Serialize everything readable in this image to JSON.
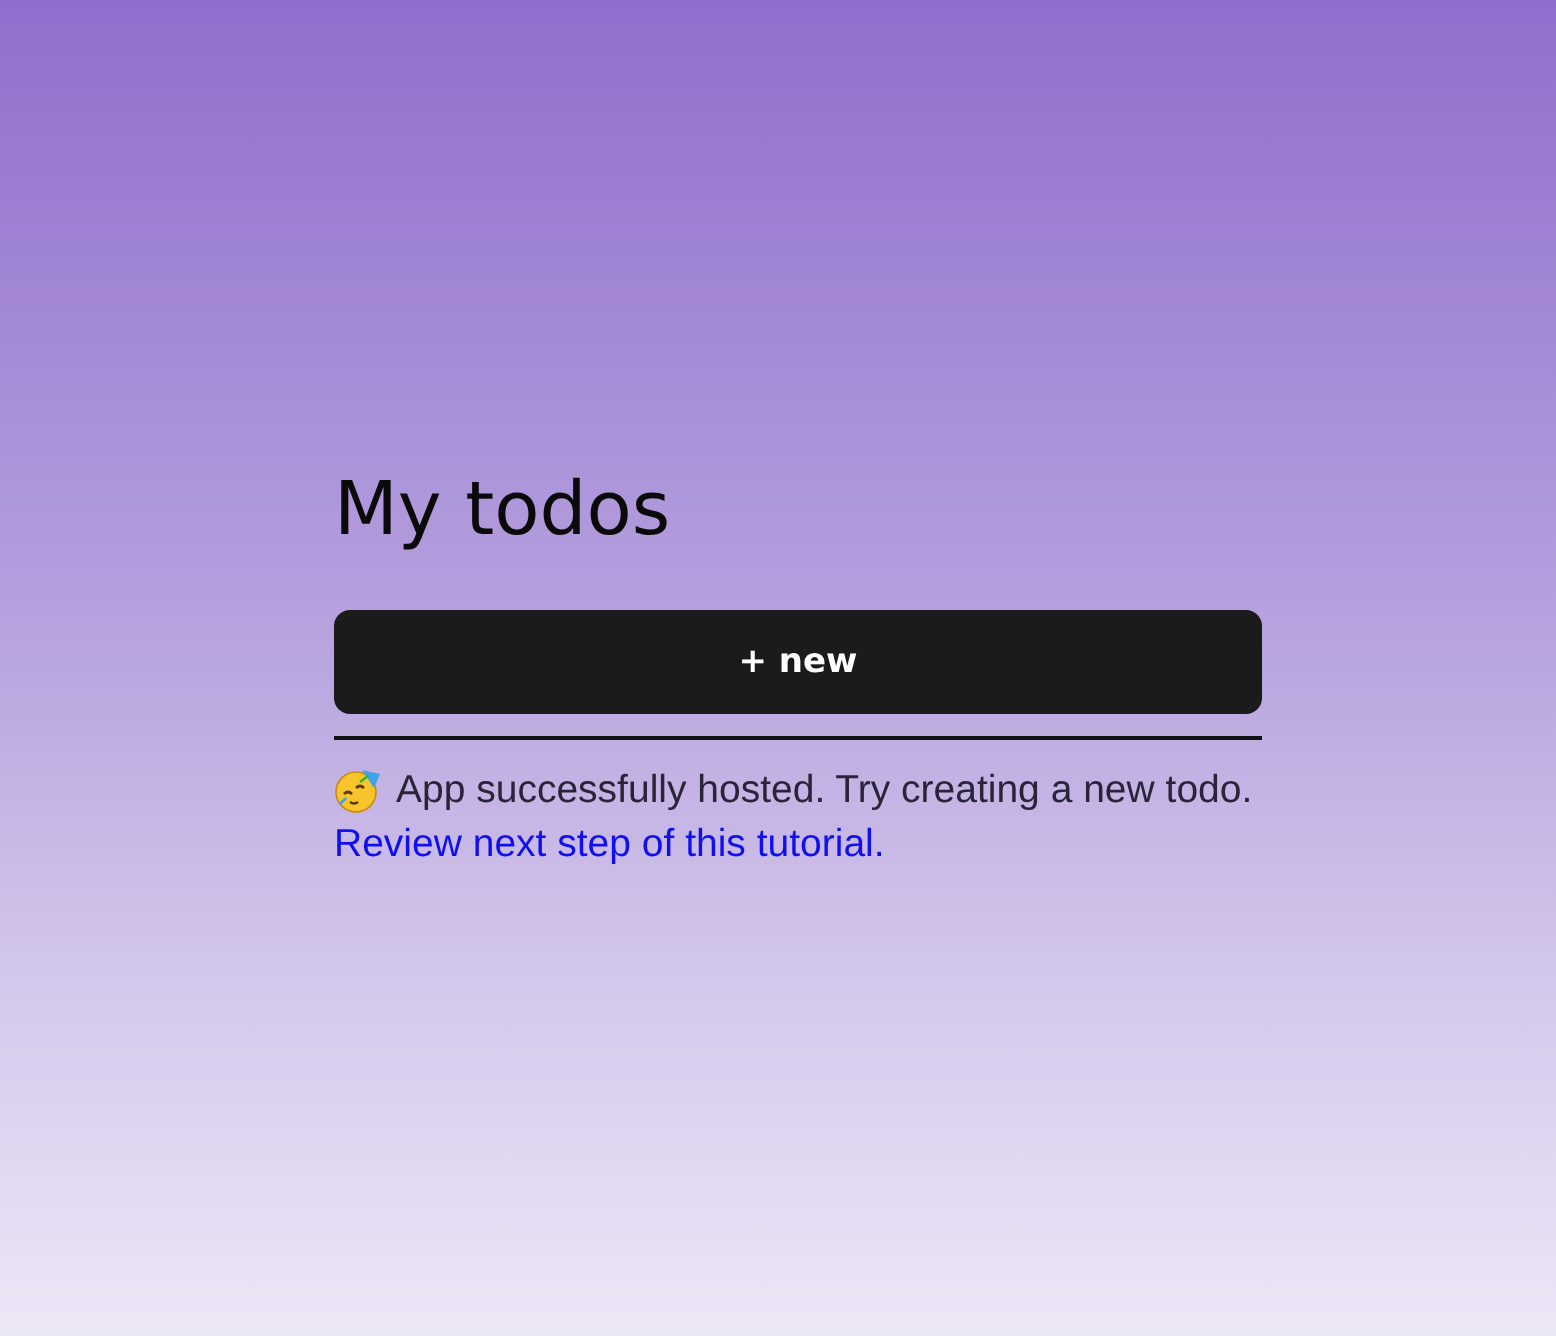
{
  "heading": "My todos",
  "new_button": {
    "label": "+ new"
  },
  "message": {
    "text": "App successfully hosted. Try creating a new todo.",
    "link": "Review next step of this tutorial."
  }
}
